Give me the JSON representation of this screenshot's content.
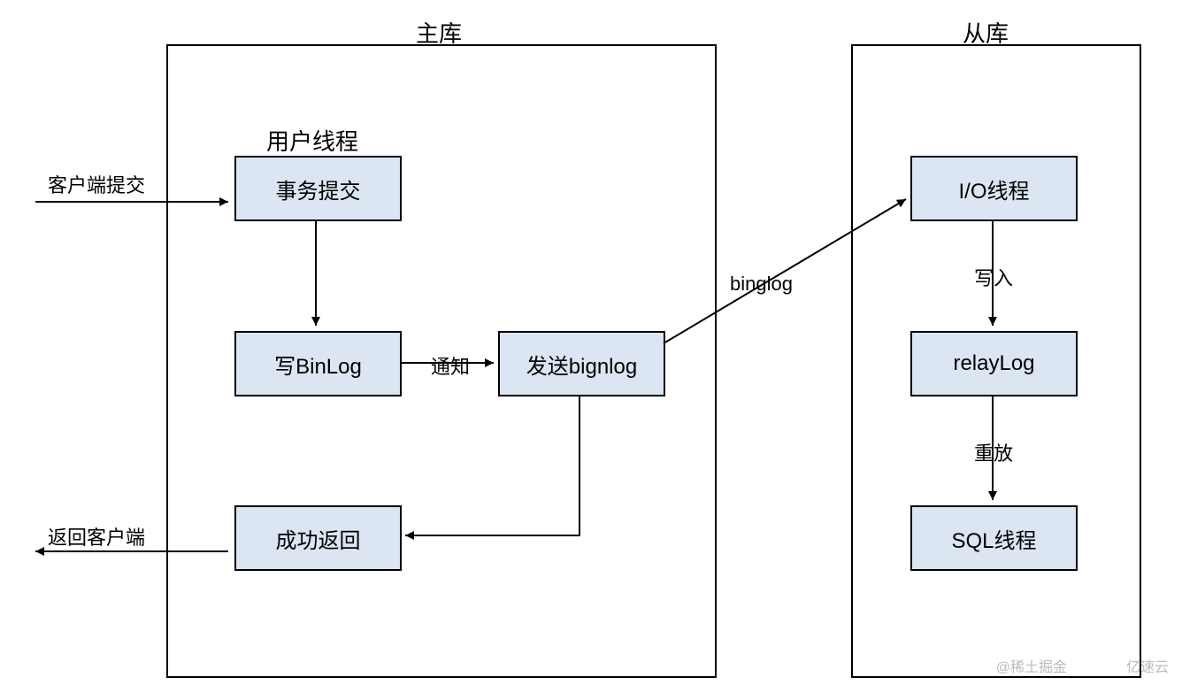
{
  "diagram": {
    "master": {
      "title": "主库",
      "userThreadTitle": "用户线程",
      "nodes": {
        "commitTx": "事务提交",
        "writeBinlog": "写BinLog",
        "sendBinlog": "发送bignlog",
        "successReturn": "成功返回"
      }
    },
    "slave": {
      "title": "从库",
      "nodes": {
        "ioThread": "I/O线程",
        "relayLog": "relayLog",
        "sqlThread": "SQL线程"
      }
    },
    "edges": {
      "clientSubmit": "客户端提交",
      "returnClient": "返回客户端",
      "notify": "通知",
      "binglog": "binglog",
      "write": "写入",
      "replay": "重放"
    },
    "watermarks": {
      "w1": "@稀土掘金",
      "w2": "亿速云"
    }
  }
}
